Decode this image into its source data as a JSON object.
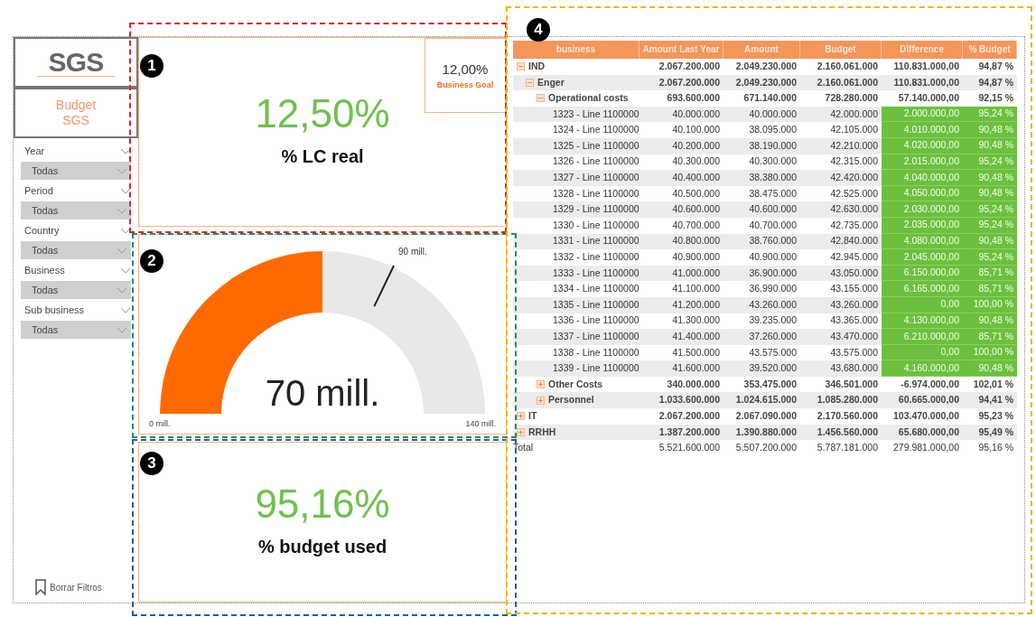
{
  "sidebar": {
    "logo": "SGS",
    "title": [
      "Budget",
      "SGS"
    ],
    "filters": [
      {
        "label": "Year",
        "value": "Todas"
      },
      {
        "label": "Period",
        "value": "Todas"
      },
      {
        "label": "Country",
        "value": "Todas"
      },
      {
        "label": "Business",
        "value": "Todas"
      },
      {
        "label": "Sub business",
        "value": "Todas"
      }
    ],
    "clear_button": "Borrar Filtros"
  },
  "kpi_lc": {
    "value": "12,50%",
    "label": "% LC real",
    "goal": {
      "value": "12,00%",
      "label": "Business Goal"
    }
  },
  "gauge": {
    "value": "70 mill.",
    "min": "0 mill.",
    "max": "140 mill.",
    "target": {
      "label": "90 mill."
    }
  },
  "kpi_budget": {
    "value": "95,16%",
    "label": "% budget used"
  },
  "table": {
    "columns": [
      "business",
      "Amount Last Year",
      "Amount",
      "Budget",
      "Difference",
      "% Budget"
    ],
    "rows": [
      {
        "kind": "group",
        "label": "IND",
        "expanded": true,
        "highlighted": false,
        "values": [
          "2.067.200.000",
          "2.049.230.000",
          "2.160.061.000",
          "110.831.000,00",
          "94,87 %"
        ],
        "children": [
          {
            "kind": "group",
            "label": "Enger",
            "expanded": true,
            "highlighted": false,
            "values": [
              "2.067.200.000",
              "2.049.230.000",
              "2.160.061.000",
              "110.831.000,00",
              "94,87 %"
            ],
            "children": [
              {
                "kind": "group",
                "label": "Operational costs",
                "expanded": true,
                "highlighted": false,
                "values": [
                  "693.600.000",
                  "671.140.000",
                  "728.280.000",
                  "57.140.000,00",
                  "92,15 %"
                ],
                "children": [
                  {
                    "kind": "line",
                    "label": "1323 - Line 1100000",
                    "highlighted": true,
                    "values": [
                      "40.000.000",
                      "40.000.000",
                      "42.000.000",
                      "2.000.000,00",
                      "95,24 %"
                    ]
                  },
                  {
                    "kind": "line",
                    "label": "1324 - Line 1100000",
                    "highlighted": true,
                    "values": [
                      "40.100.000",
                      "38.095.000",
                      "42.105.000",
                      "4.010.000,00",
                      "90,48 %"
                    ]
                  },
                  {
                    "kind": "line",
                    "label": "1325 - Line 1100000",
                    "highlighted": true,
                    "values": [
                      "40.200.000",
                      "38.190.000",
                      "42.210.000",
                      "4.020.000,00",
                      "90,48 %"
                    ]
                  },
                  {
                    "kind": "line",
                    "label": "1326 - Line 1100000",
                    "highlighted": true,
                    "values": [
                      "40.300.000",
                      "40.300.000",
                      "42.315.000",
                      "2.015.000,00",
                      "95,24 %"
                    ]
                  },
                  {
                    "kind": "line",
                    "label": "1327 - Line 1100000",
                    "highlighted": true,
                    "values": [
                      "40.400.000",
                      "38.380.000",
                      "42.420.000",
                      "4.040.000,00",
                      "90,48 %"
                    ]
                  },
                  {
                    "kind": "line",
                    "label": "1328 - Line 1100000",
                    "highlighted": true,
                    "values": [
                      "40.500.000",
                      "38.475.000",
                      "42.525.000",
                      "4.050.000,00",
                      "90,48 %"
                    ]
                  },
                  {
                    "kind": "line",
                    "label": "1329 - Line 1100000",
                    "highlighted": true,
                    "values": [
                      "40.600.000",
                      "40.600.000",
                      "42.630.000",
                      "2.030.000,00",
                      "95,24 %"
                    ]
                  },
                  {
                    "kind": "line",
                    "label": "1330 - Line 1100000",
                    "highlighted": true,
                    "values": [
                      "40.700.000",
                      "40.700.000",
                      "42.735.000",
                      "2.035.000,00",
                      "95,24 %"
                    ]
                  },
                  {
                    "kind": "line",
                    "label": "1331 - Line 1100000",
                    "highlighted": true,
                    "values": [
                      "40.800.000",
                      "38.760.000",
                      "42.840.000",
                      "4.080.000,00",
                      "90,48 %"
                    ]
                  },
                  {
                    "kind": "line",
                    "label": "1332 - Line 1100000",
                    "highlighted": true,
                    "values": [
                      "40.900.000",
                      "40.900.000",
                      "42.945.000",
                      "2.045.000,00",
                      "95,24 %"
                    ]
                  },
                  {
                    "kind": "line",
                    "label": "1333 - Line 1100000",
                    "highlighted": true,
                    "values": [
                      "41.000.000",
                      "36.900.000",
                      "43.050.000",
                      "6.150.000,00",
                      "85,71 %"
                    ]
                  },
                  {
                    "kind": "line",
                    "label": "1334 - Line 1100000",
                    "highlighted": true,
                    "values": [
                      "41.100.000",
                      "36.990.000",
                      "43.155.000",
                      "6.165.000,00",
                      "85,71 %"
                    ]
                  },
                  {
                    "kind": "line",
                    "label": "1335 - Line 1100000",
                    "highlighted": true,
                    "values": [
                      "41.200.000",
                      "43.260.000",
                      "43.260.000",
                      "0,00",
                      "100,00 %"
                    ]
                  },
                  {
                    "kind": "line",
                    "label": "1336 - Line 1100000",
                    "highlighted": true,
                    "values": [
                      "41.300.000",
                      "39.235.000",
                      "43.365.000",
                      "4.130.000,00",
                      "90,48 %"
                    ]
                  },
                  {
                    "kind": "line",
                    "label": "1337 - Line 1100000",
                    "highlighted": true,
                    "values": [
                      "41.400.000",
                      "37.260.000",
                      "43.470.000",
                      "6.210.000,00",
                      "85,71 %"
                    ]
                  },
                  {
                    "kind": "line",
                    "label": "1338 - Line 1100000",
                    "highlighted": true,
                    "values": [
                      "41.500.000",
                      "43.575.000",
                      "43.575.000",
                      "0,00",
                      "100,00 %"
                    ]
                  },
                  {
                    "kind": "line",
                    "label": "1339 - Line 1100000",
                    "highlighted": true,
                    "values": [
                      "41.600.000",
                      "39.520.000",
                      "43.680.000",
                      "4.160.000,00",
                      "90,48 %"
                    ]
                  }
                ]
              },
              {
                "kind": "group",
                "label": "Other Costs",
                "expanded": false,
                "highlighted": false,
                "values": [
                  "340.000.000",
                  "353.475.000",
                  "346.501.000",
                  "-6.974.000,00",
                  "102,01 %"
                ]
              },
              {
                "kind": "group",
                "label": "Personnel",
                "expanded": false,
                "highlighted": false,
                "values": [
                  "1.033.600.000",
                  "1.024.615.000",
                  "1.085.280.000",
                  "60.665.000,00",
                  "94,41 %"
                ]
              }
            ]
          }
        ]
      },
      {
        "kind": "group",
        "label": "IT",
        "expanded": false,
        "highlighted": false,
        "values": [
          "2.067.200.000",
          "2.067.090.000",
          "2.170.560.000",
          "103.470.000,00",
          "95,23 %"
        ]
      },
      {
        "kind": "group",
        "label": "RRHH",
        "expanded": false,
        "highlighted": false,
        "values": [
          "1.387.200.000",
          "1.390.880.000",
          "1.456.560.000",
          "65.680.000,00",
          "95,49 %"
        ]
      },
      {
        "kind": "total",
        "label": "Total",
        "highlighted": false,
        "values": [
          "5.521.600.000",
          "5.507.200.000",
          "5.787.181.000",
          "279.981.000,00",
          "95,16 %"
        ]
      }
    ]
  },
  "annotations": [
    {
      "label": "1",
      "color": "#d62728"
    },
    {
      "label": "2",
      "color": "#1f8a6e"
    },
    {
      "label": "3",
      "color": "#1f5f99"
    },
    {
      "label": "4",
      "color": "#f0b400"
    }
  ]
}
